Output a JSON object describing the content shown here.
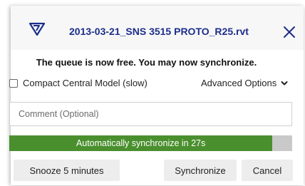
{
  "dialog": {
    "title": "2013-03-21_SNS 3515 PROTO_R25.rvt",
    "logo_icon": "revit-logo-icon",
    "close_icon": "close-icon",
    "title_color": "#1c2e8a"
  },
  "message": "The queue is now free. You may now synchronize.",
  "options": {
    "compact_label": "Compact Central Model (slow)",
    "compact_checked": false,
    "advanced_label": "Advanced Options",
    "advanced_icon": "chevron-down-icon"
  },
  "comment": {
    "placeholder": "Comment (Optional)",
    "value": ""
  },
  "countdown": {
    "text": "Automatically synchronize in 27s",
    "progress_fraction": 0.93,
    "fill_color": "#4a8f2e"
  },
  "buttons": {
    "snooze": "Snooze 5 minutes",
    "synchronize": "Synchronize",
    "cancel": "Cancel"
  }
}
